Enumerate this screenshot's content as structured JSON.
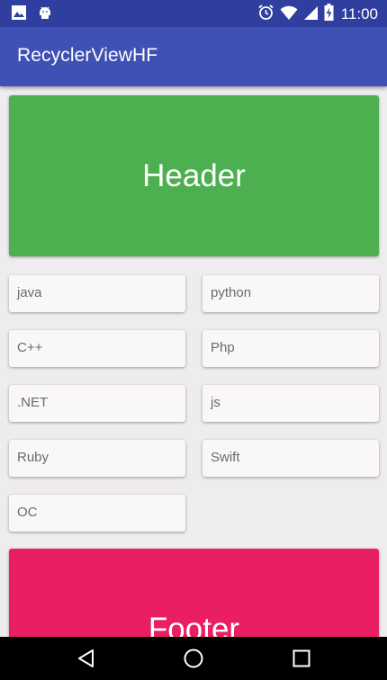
{
  "status_bar": {
    "time": "11:00",
    "left_icons": [
      "image-notification-icon",
      "android-debug-icon"
    ],
    "right_icons": [
      "alarm-icon",
      "wifi-icon",
      "cell-signal-icon",
      "battery-charging-icon"
    ]
  },
  "app_bar": {
    "title": "RecyclerViewHF",
    "color": "#3f51b5",
    "status_color": "#303f9f"
  },
  "list": {
    "header": {
      "label": "Header",
      "color": "#4caf50"
    },
    "items": [
      {
        "label": "java"
      },
      {
        "label": "python"
      },
      {
        "label": "C++"
      },
      {
        "label": "Php"
      },
      {
        "label": ".NET"
      },
      {
        "label": "js"
      },
      {
        "label": "Ruby"
      },
      {
        "label": "Swift"
      },
      {
        "label": "OC"
      }
    ],
    "footer": {
      "label": "Footer",
      "color": "#e91e63"
    }
  },
  "nav_bar": {
    "buttons": [
      "back-icon",
      "home-icon",
      "recents-icon"
    ]
  }
}
